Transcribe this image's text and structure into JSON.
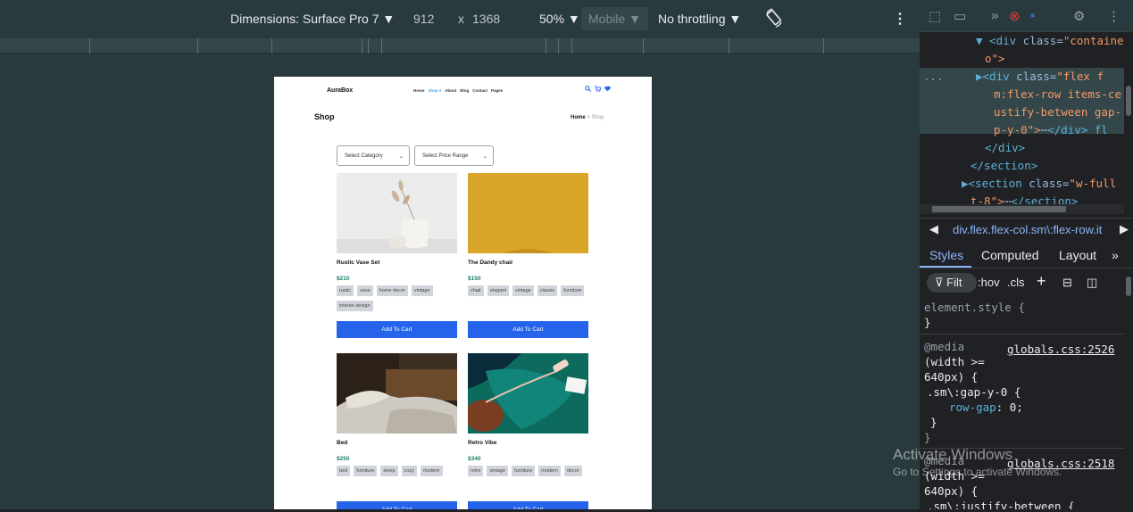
{
  "device_toolbar": {
    "dimensions": "Dimensions: Surface Pro 7 ▼",
    "width": "912",
    "times": "x",
    "height": "1368",
    "zoom": "50% ▼",
    "mode": "Mobile ▼",
    "throttling": "No throttling ▼",
    "rotate_icon": "rotate-icon",
    "more_icon": "⋮"
  },
  "page": {
    "logo": "AuraBox",
    "nav": [
      "Home",
      "Shop ▾",
      "About",
      "Blog",
      "Contact",
      "Pages"
    ],
    "title": "Shop",
    "breadcrumb_home": "Home",
    "breadcrumb_sep": ">",
    "breadcrumb_current": "Shop",
    "category_select": "Select Category",
    "price_select": "Select Price Range",
    "add_to_cart": "Add To Cart",
    "products": [
      {
        "name": "Rustic Vase Set",
        "price": "$210",
        "tags": [
          "rustic",
          "vase",
          "home decor",
          "vintage",
          "interior design"
        ]
      },
      {
        "name": "The Dandy chair",
        "price": "$150",
        "tags": [
          "chair",
          "elegant",
          "vintage",
          "classic",
          "furniture"
        ]
      },
      {
        "name": "Bed",
        "price": "$250",
        "tags": [
          "bed",
          "furniture",
          "sleep",
          "cozy",
          "modern"
        ]
      },
      {
        "name": "Retro Vibe",
        "price": "$340",
        "tags": [
          "retro",
          "vintage",
          "furniture",
          "modern",
          "decor"
        ]
      }
    ]
  },
  "devtools": {
    "dom": {
      "line1_tag": "▼ <div",
      "line1_attr": " class=",
      "line1_val": "\"containe",
      "line2": "o\">",
      "line3_tag": "▶<div",
      "line3_attr": " class=",
      "line3_val": "\"flex f",
      "line4": "m:flex-row items-ce",
      "line5": "ustify-between gap-",
      "line6": "p-y-0\">",
      "line6_rest": "</div>",
      "line6_badge": "fl",
      "line7": "</div>",
      "line8": "</section>",
      "line9_tag": "▶<section",
      "line9_attr": " class=",
      "line9_val": "\"w-full",
      "line10": "t-8\">",
      "line10_rest": "</section>",
      "dots": "..."
    },
    "selected_breadcrumb": "div.flex.flex-col.sm\\:flex-row.it",
    "tabs": [
      "Styles",
      "Computed",
      "Layout",
      "»"
    ],
    "filter_placeholder": "Filt",
    "hov": ":hov",
    "cls": ".cls",
    "styles": {
      "element_style": "element.style {",
      "close": "}",
      "media1": "@media",
      "media1_src": "globals.css:2526",
      "media1_cond": "(width >=",
      "media1_cond2": "640px) {",
      "rule1_sel": ".sm\\:gap-y-0 {",
      "rule1_prop": "row-gap",
      "rule1_val": ": 0;",
      "rule1_close": "}",
      "media_close": "}",
      "media2": "@media",
      "media2_src": "globals.css:2518",
      "media2_cond": "(width >=",
      "media2_cond2": "640px) {",
      "rule2_sel": ".sm\\:justify-between {"
    }
  },
  "watermark": {
    "title": "Activate Windows",
    "subtitle": "Go to Settings to activate Windows."
  }
}
